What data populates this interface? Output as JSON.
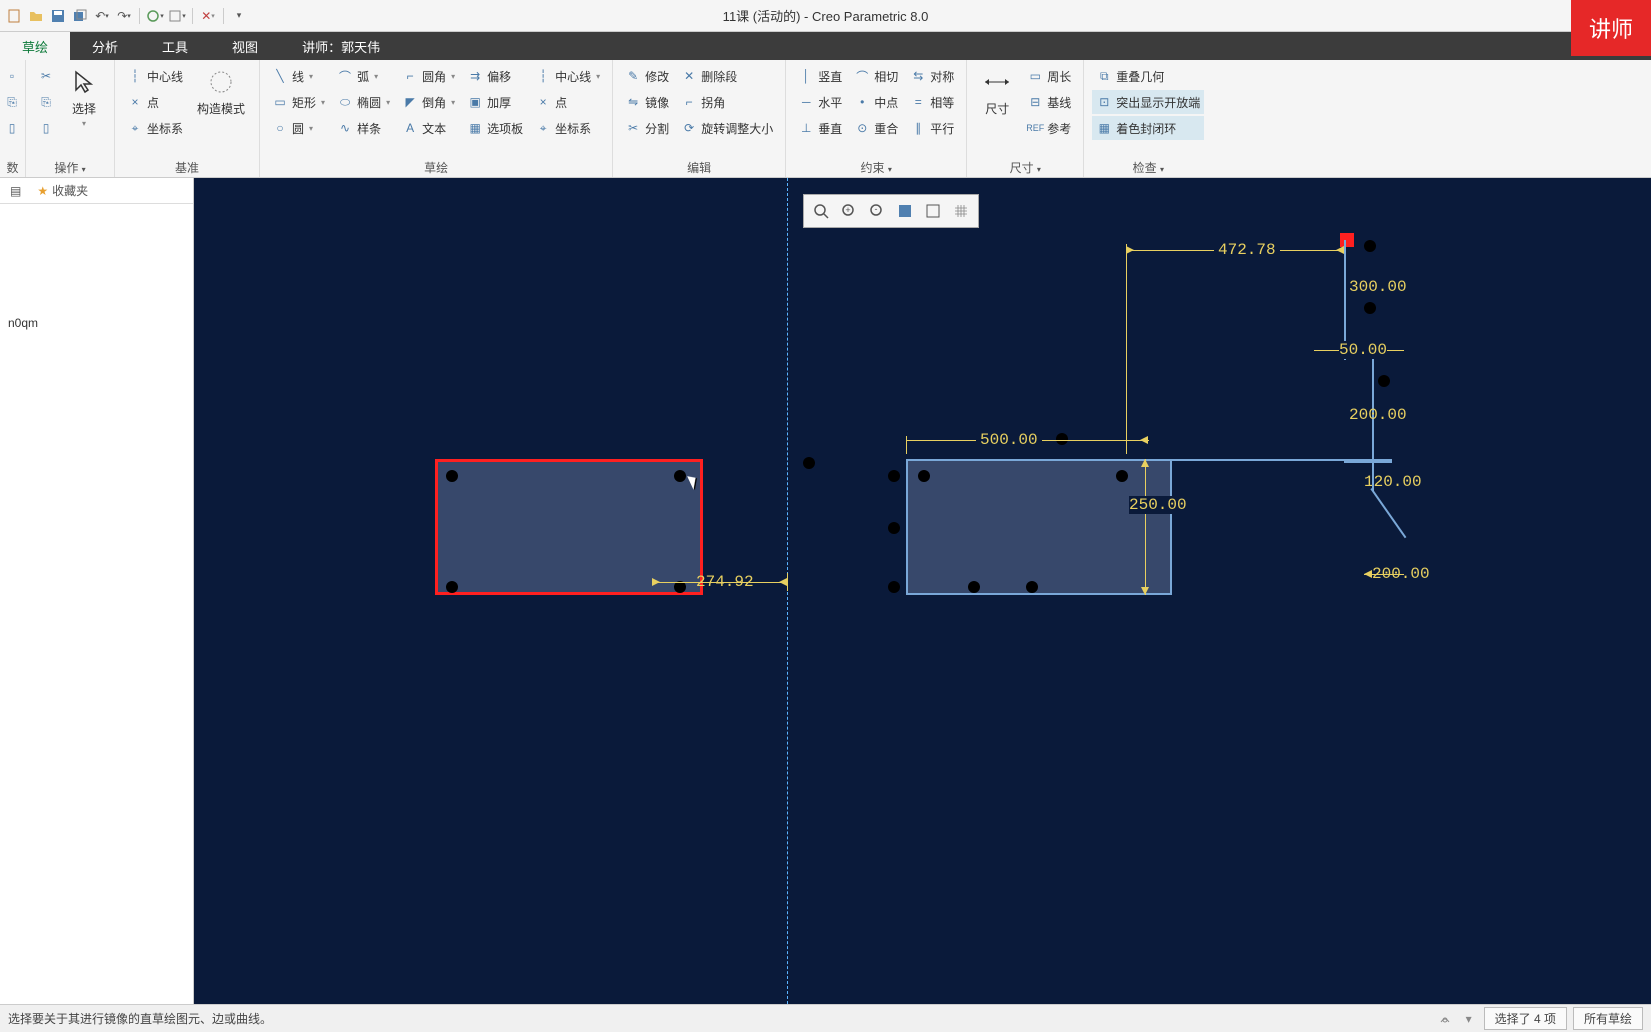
{
  "title": "11课 (活动的) - Creo Parametric 8.0",
  "badge": "讲师",
  "tabs": {
    "sketch": "草绘",
    "analysis": "分析",
    "tools": "工具",
    "view": "视图",
    "instructor": "讲师：郭天伟"
  },
  "ribbon": {
    "data_label": "数据",
    "ops_label": "操作",
    "select_label": "选择",
    "datum_label": "基准",
    "centerline": "中心线",
    "point": "点",
    "csys": "坐标系",
    "construct_mode": "构造模式",
    "sketch_label": "草绘",
    "line": "线",
    "rectangle": "矩形",
    "circle": "圆",
    "arc": "弧",
    "ellipse": "椭圆",
    "spline": "样条",
    "fillet": "圆角",
    "chamfer": "倒角",
    "text": "文本",
    "offset": "偏移",
    "thicken": "加厚",
    "palette": "选项板",
    "centerline2": "中心线",
    "point2": "点",
    "csys2": "坐标系",
    "edit_label": "编辑",
    "modify": "修改",
    "mirror": "镜像",
    "divide": "分割",
    "delete_seg": "删除段",
    "corner": "拐角",
    "rotate_resize": "旋转调整大小",
    "constraint_label": "约束",
    "vertical": "竖直",
    "horizontal": "水平",
    "perpendicular": "垂直",
    "tangent": "相切",
    "midpoint": "中点",
    "coincident": "重合",
    "symmetric": "对称",
    "equal": "相等",
    "parallel": "平行",
    "dimension_label": "尺寸",
    "dim_big": "尺寸",
    "perimeter": "周长",
    "baseline": "基线",
    "reference": "参考",
    "inspect_label": "检查",
    "overlap_geom": "重叠几何",
    "highlight_open": "突出显示开放端",
    "shade_closed": "着色封闭环"
  },
  "tree": {
    "favorites": "收藏夹",
    "item1": "n0qm"
  },
  "dimensions": {
    "d1": "274.92",
    "d2": "500.00",
    "d3": "250.00",
    "d4": "472.78",
    "d5": "300.00",
    "d6": "50.00",
    "d7": "200.00",
    "d8": "120.00",
    "d9": "200.00"
  },
  "status": {
    "message": "选择要关于其进行镜像的直草绘图元、边或曲线。",
    "selection": "选择了 4 项",
    "filter": "所有草绘"
  }
}
